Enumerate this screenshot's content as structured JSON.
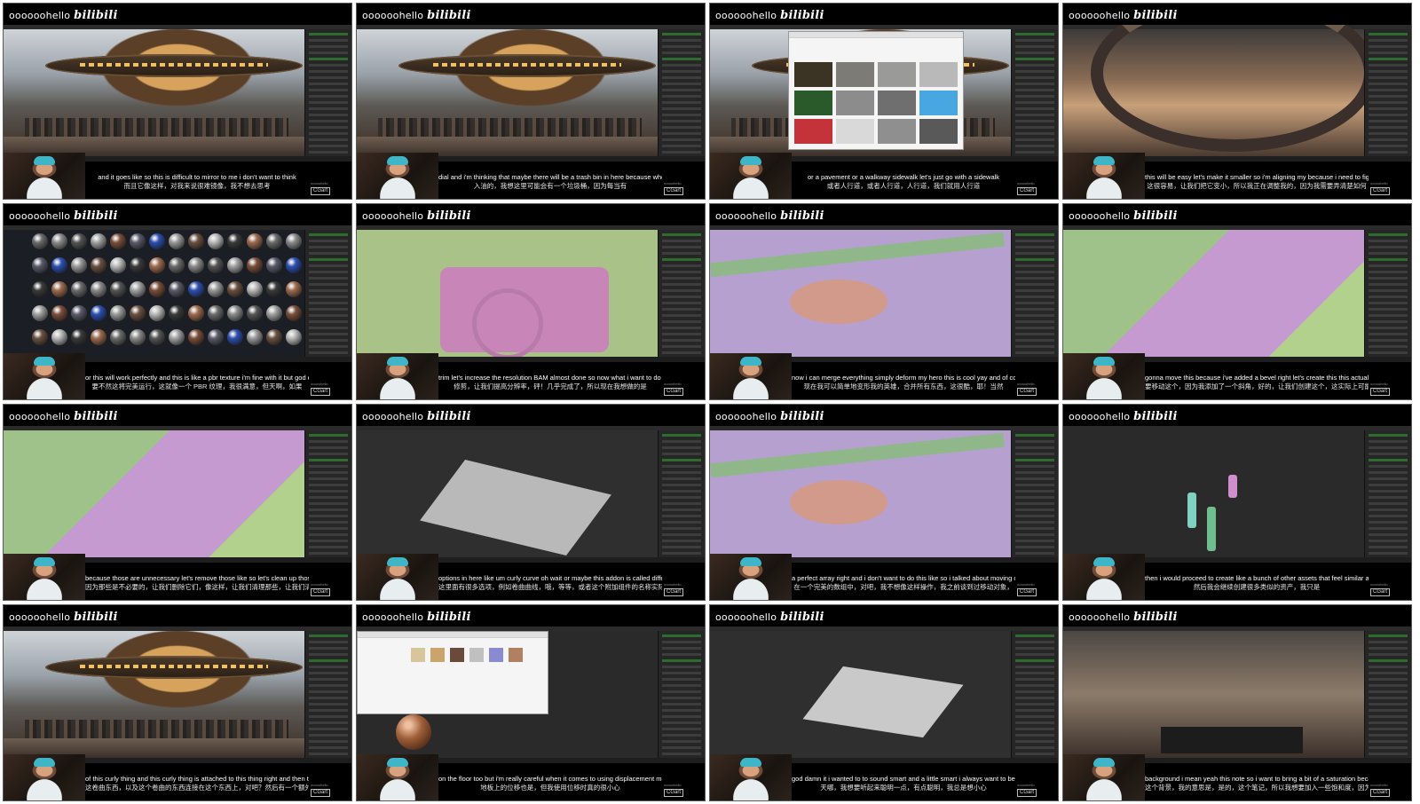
{
  "watermark": {
    "handle": "oooooohello",
    "logo": "bilibili"
  },
  "info_lines": [
    "ooooohello",
    "CGart"
  ],
  "thumbnails": [
    {
      "scene": "station",
      "en": "and it goes like so this is difficult to mirror to me i don't want to think",
      "zh": "而且它像这样，对我来说很难镜像，我不想去思考"
    },
    {
      "scene": "station",
      "en": "dial and i'm thinking that maybe there will be a trash bin in here because whenever there is",
      "zh": "入油的，我想这里可能会有一个垃圾桶，因为每当有"
    },
    {
      "scene": "browser",
      "en": "or a pavement or a walkway sidewalk let's just go with a sidewalk",
      "zh": "或者人行道，或者人行道，人行道，我们就用人行道"
    },
    {
      "scene": "ring",
      "en": "this will be easy let's make it smaller so i'm aligning my because i need to figure out how",
      "zh": "这很容易，让我们把它变小，所以我正在调整我的，因为我需要弄清楚如何"
    },
    {
      "scene": "matgrid",
      "en": "or this will work perfectly and this is like a pbr texture i'm fine with it but god damn it if",
      "zh": "要不然这将完美运行，这就像一个 PBR 纹理，我很满意，但天啊，如果"
    },
    {
      "scene": "green",
      "en": "trim let's increase the resolution BAM almost done so now what i want to do is",
      "zh": "修剪，让我们提高分辨率，砰！几乎完成了，所以现在我想做的是"
    },
    {
      "scene": "pink",
      "en": "now i can merge everything simply deform my hero this is cool yay and of course i",
      "zh": "现在我可以简单地变形我的英雄，合并所有东西，这很酷，耶！当然"
    },
    {
      "scene": "pinkgreen",
      "en": "gonna move this because i've added a bevel right let's create this this actually could work",
      "zh": "要移动这个，因为我添加了一个斜角，好的，让我们创建这个，这实际上可能行得通"
    },
    {
      "scene": "pinkgreen",
      "en": "because those are unnecessary let's remove those like so let's clean up those let's clean up",
      "zh": "因为那些是不必要的，让我们删除它们，像这样，让我们清理那些，让我们清理"
    },
    {
      "scene": "plane",
      "en": "options in here like um curly curve oh wait or maybe this addon is called differently actually",
      "zh": "这里面有很多选项，例如卷曲曲线，哦，等等，或者这个附加组件的名称实际上可能不同"
    },
    {
      "scene": "pink",
      "en": "a perfect array right and i don't want to do this like so i talked about moving objects to",
      "zh": "在一个完美的数组中，对吧，我不想像这样操作，我之前谈到过移动对象，"
    },
    {
      "scene": "tubes",
      "en": "then i would proceed to create like a bunch of other assets that feel similar and i'm only",
      "zh": "然后我会继续创建很多类似的资产，我只是"
    },
    {
      "scene": "station",
      "en": "of this curly thing and this curly thing is attached to this thing right and then there's a",
      "zh": "这卷曲东西，以及这个卷曲的东西连接在这个东西上，对吧？然后有一个额外的元素，仅仅是为了突出轮廓，然后，他们看起来有点不同。我们已经有了这个想法。我决定采用这个。"
    },
    {
      "scene": "explorer",
      "en": "on the floor too but i'm really careful when it comes to using displacement meaning",
      "zh": "地板上的位移也是，但我使用位移时真的很小心"
    },
    {
      "scene": "plane2",
      "en": "god damn it i wanted to to sound smart and a little smart i always want to be careful",
      "zh": "天哪，我想要听起来聪明一点，有点聪明，我总是想小心"
    },
    {
      "scene": "node",
      "en": "background i mean yeah this note so i want to bring a bit of a saturation because i want for",
      "zh": "这个背景，我的意思是，是的，这个笔记，所以我想要加入一些饱和度，因为我希望"
    }
  ]
}
